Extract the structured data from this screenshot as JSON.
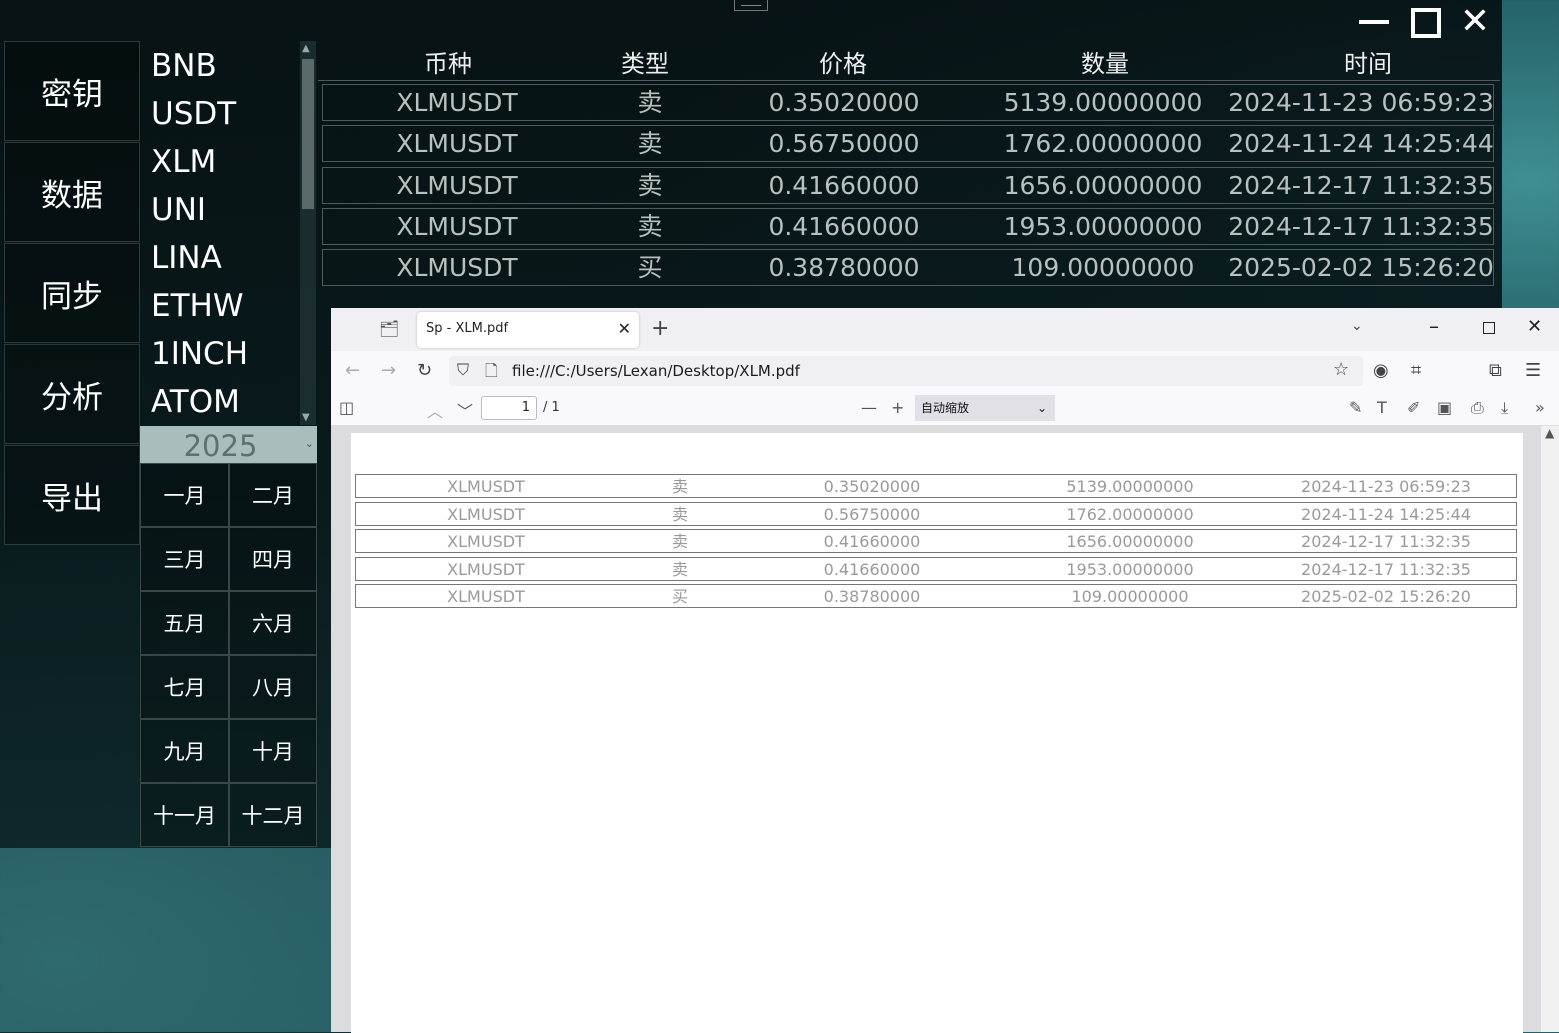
{
  "nav": [
    "密钥",
    "数据",
    "同步",
    "分析",
    "导出"
  ],
  "coins": [
    "BNB",
    "USDT",
    "XLM",
    "UNI",
    "LINA",
    "ETHW",
    "1INCH",
    "ATOM"
  ],
  "year": "2025",
  "months": [
    "一月",
    "二月",
    "三月",
    "四月",
    "五月",
    "六月",
    "七月",
    "八月",
    "九月",
    "十月",
    "十一月",
    "十二月"
  ],
  "table": {
    "headers": [
      "币种",
      "类型",
      "价格",
      "数量",
      "时间"
    ],
    "rows": [
      [
        "XLMUSDT",
        "卖",
        "0.35020000",
        "5139.00000000",
        "2024-11-23 06:59:23"
      ],
      [
        "XLMUSDT",
        "卖",
        "0.56750000",
        "1762.00000000",
        "2024-11-24 14:25:44"
      ],
      [
        "XLMUSDT",
        "卖",
        "0.41660000",
        "1656.00000000",
        "2024-12-17 11:32:35"
      ],
      [
        "XLMUSDT",
        "卖",
        "0.41660000",
        "1953.00000000",
        "2024-12-17 11:32:35"
      ],
      [
        "XLMUSDT",
        "买",
        "0.38780000",
        "109.00000000",
        "2025-02-02 15:26:20"
      ]
    ]
  },
  "browser": {
    "tab_title": "Sp - XLM.pdf",
    "url": "file:///C:/Users/Lexan/Desktop/XLM.pdf",
    "page_number": "1",
    "page_total": "/ 1",
    "zoom": "自动缩放"
  }
}
